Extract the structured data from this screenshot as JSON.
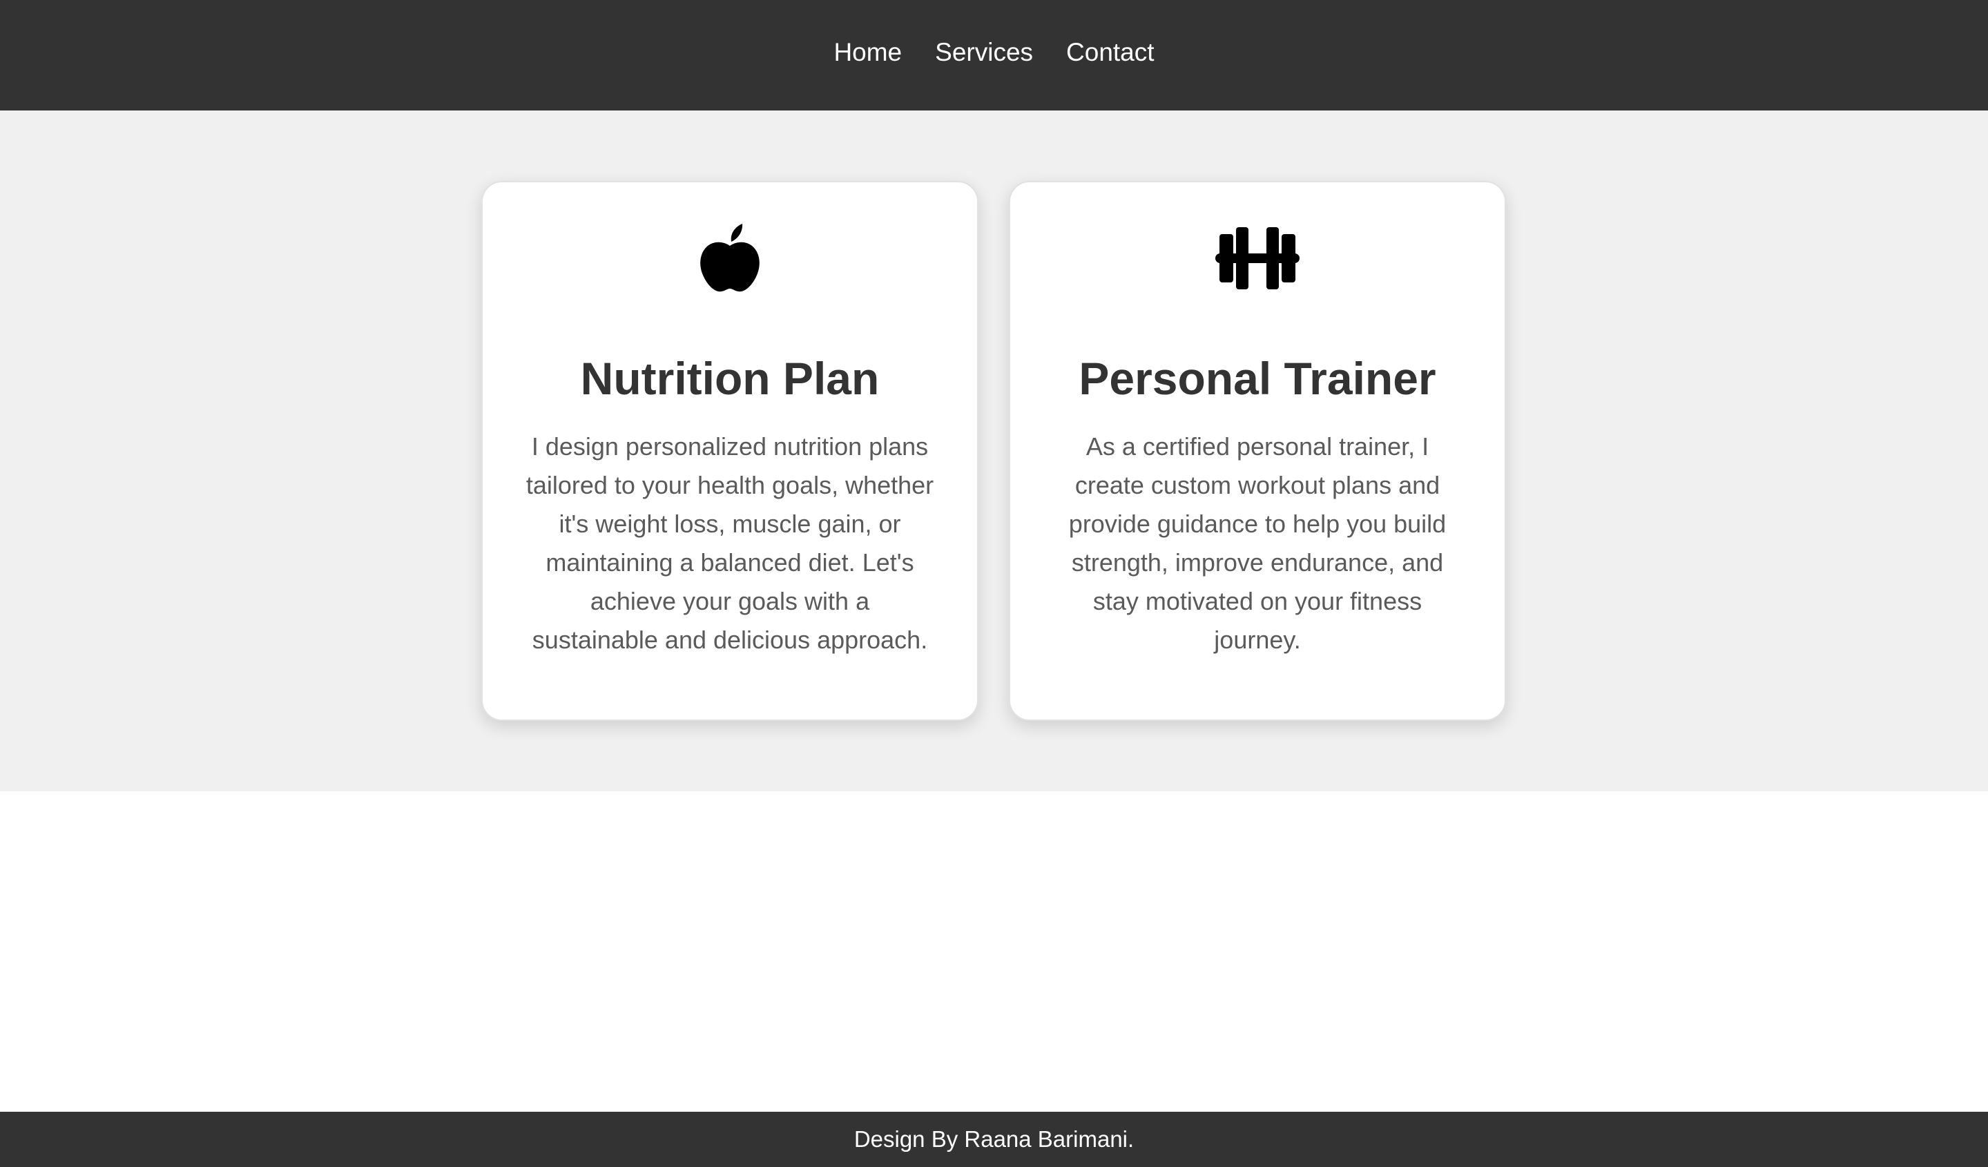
{
  "nav": {
    "items": [
      {
        "label": "Home"
      },
      {
        "label": "Services"
      },
      {
        "label": "Contact"
      }
    ]
  },
  "services": {
    "cards": [
      {
        "icon": "apple-icon",
        "title": "Nutrition Plan",
        "description": "I design personalized nutrition plans tailored to your health goals, whether it's weight loss, muscle gain, or maintaining a balanced diet. Let's achieve your goals with a sustainable and delicious approach."
      },
      {
        "icon": "dumbbell-icon",
        "title": "Personal Trainer",
        "description": "As a certified personal trainer, I create custom workout plans and provide guidance to help you build strength, improve endurance, and stay motivated on your fitness journey."
      }
    ]
  },
  "footer": {
    "text": "Design By Raana Barimani."
  },
  "colors": {
    "header_bg": "#333333",
    "section_bg": "#f0f0f0",
    "card_bg": "#ffffff",
    "title_text": "#333333",
    "body_text": "#5a5a5a"
  }
}
